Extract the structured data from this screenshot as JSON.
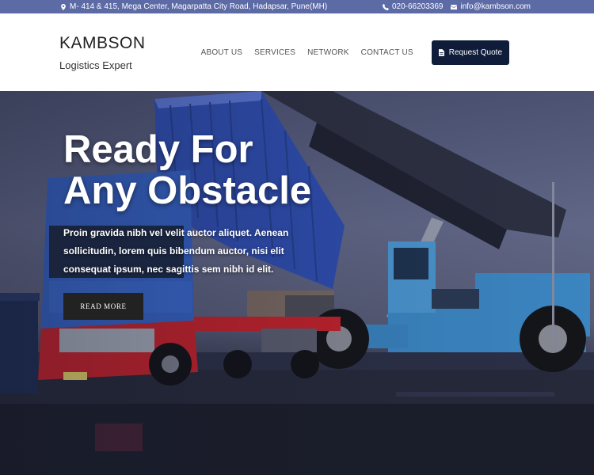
{
  "topbar": {
    "address": "M- 414 & 415, Mega Center, Magarpatta City Road, Hadapsar, Pune(MH)",
    "phone": "020-66203369",
    "email": "info@kambson.com",
    "icons": [
      "map-marker-icon",
      "phone-icon",
      "envelope-icon"
    ]
  },
  "header": {
    "brand_name": "KAMBSON",
    "tagline": "Logistics Expert",
    "nav": [
      "ABOUT US",
      "SERVICES",
      "NETWORK",
      "CONTACT US"
    ],
    "cta": {
      "label": "Request Quote",
      "icon": "document-icon"
    }
  },
  "hero": {
    "title": "Ready For Any Obstacle",
    "text": "Proin gravida nibh vel velit auctor aliquet. Aenean sollicitudin, lorem quis bibendum auctor, nisi elit consequat ipsum, nec sagittis sem nibh id elit.",
    "button": "READ MORE"
  },
  "colors": {
    "topbar": "#5c6aa6",
    "cta": "#0f1c3a",
    "read_more": "#222222",
    "truck_blue": "#3563c7",
    "truck_red": "#c8222b",
    "container_blue": "#2f4fb4",
    "loader_blue": "#3d8bc9"
  }
}
